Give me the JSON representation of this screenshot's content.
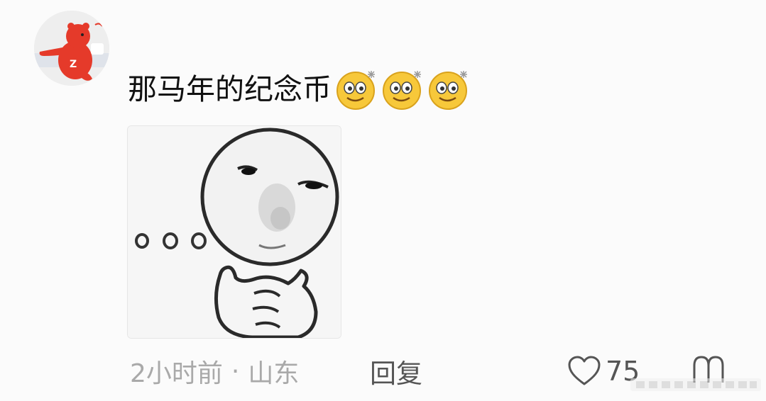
{
  "comment": {
    "avatar_icon": "red-bear-avatar",
    "text": "那马年的纪念币",
    "emojis": [
      "dizzy-smile-emoji",
      "dizzy-smile-emoji",
      "dizzy-smile-emoji"
    ],
    "sticker_icon": "thinking-face-sticker",
    "meta": {
      "time": "2小时前",
      "separator": "·",
      "location": "山东"
    },
    "reply_label": "回复",
    "like_count": "75"
  },
  "colors": {
    "background": "#fbfbfb",
    "text": "#111111",
    "meta_text": "#a9a9a9",
    "avatar_bear": "#e53a2a",
    "emoji_yellow": "#f7c83a"
  }
}
